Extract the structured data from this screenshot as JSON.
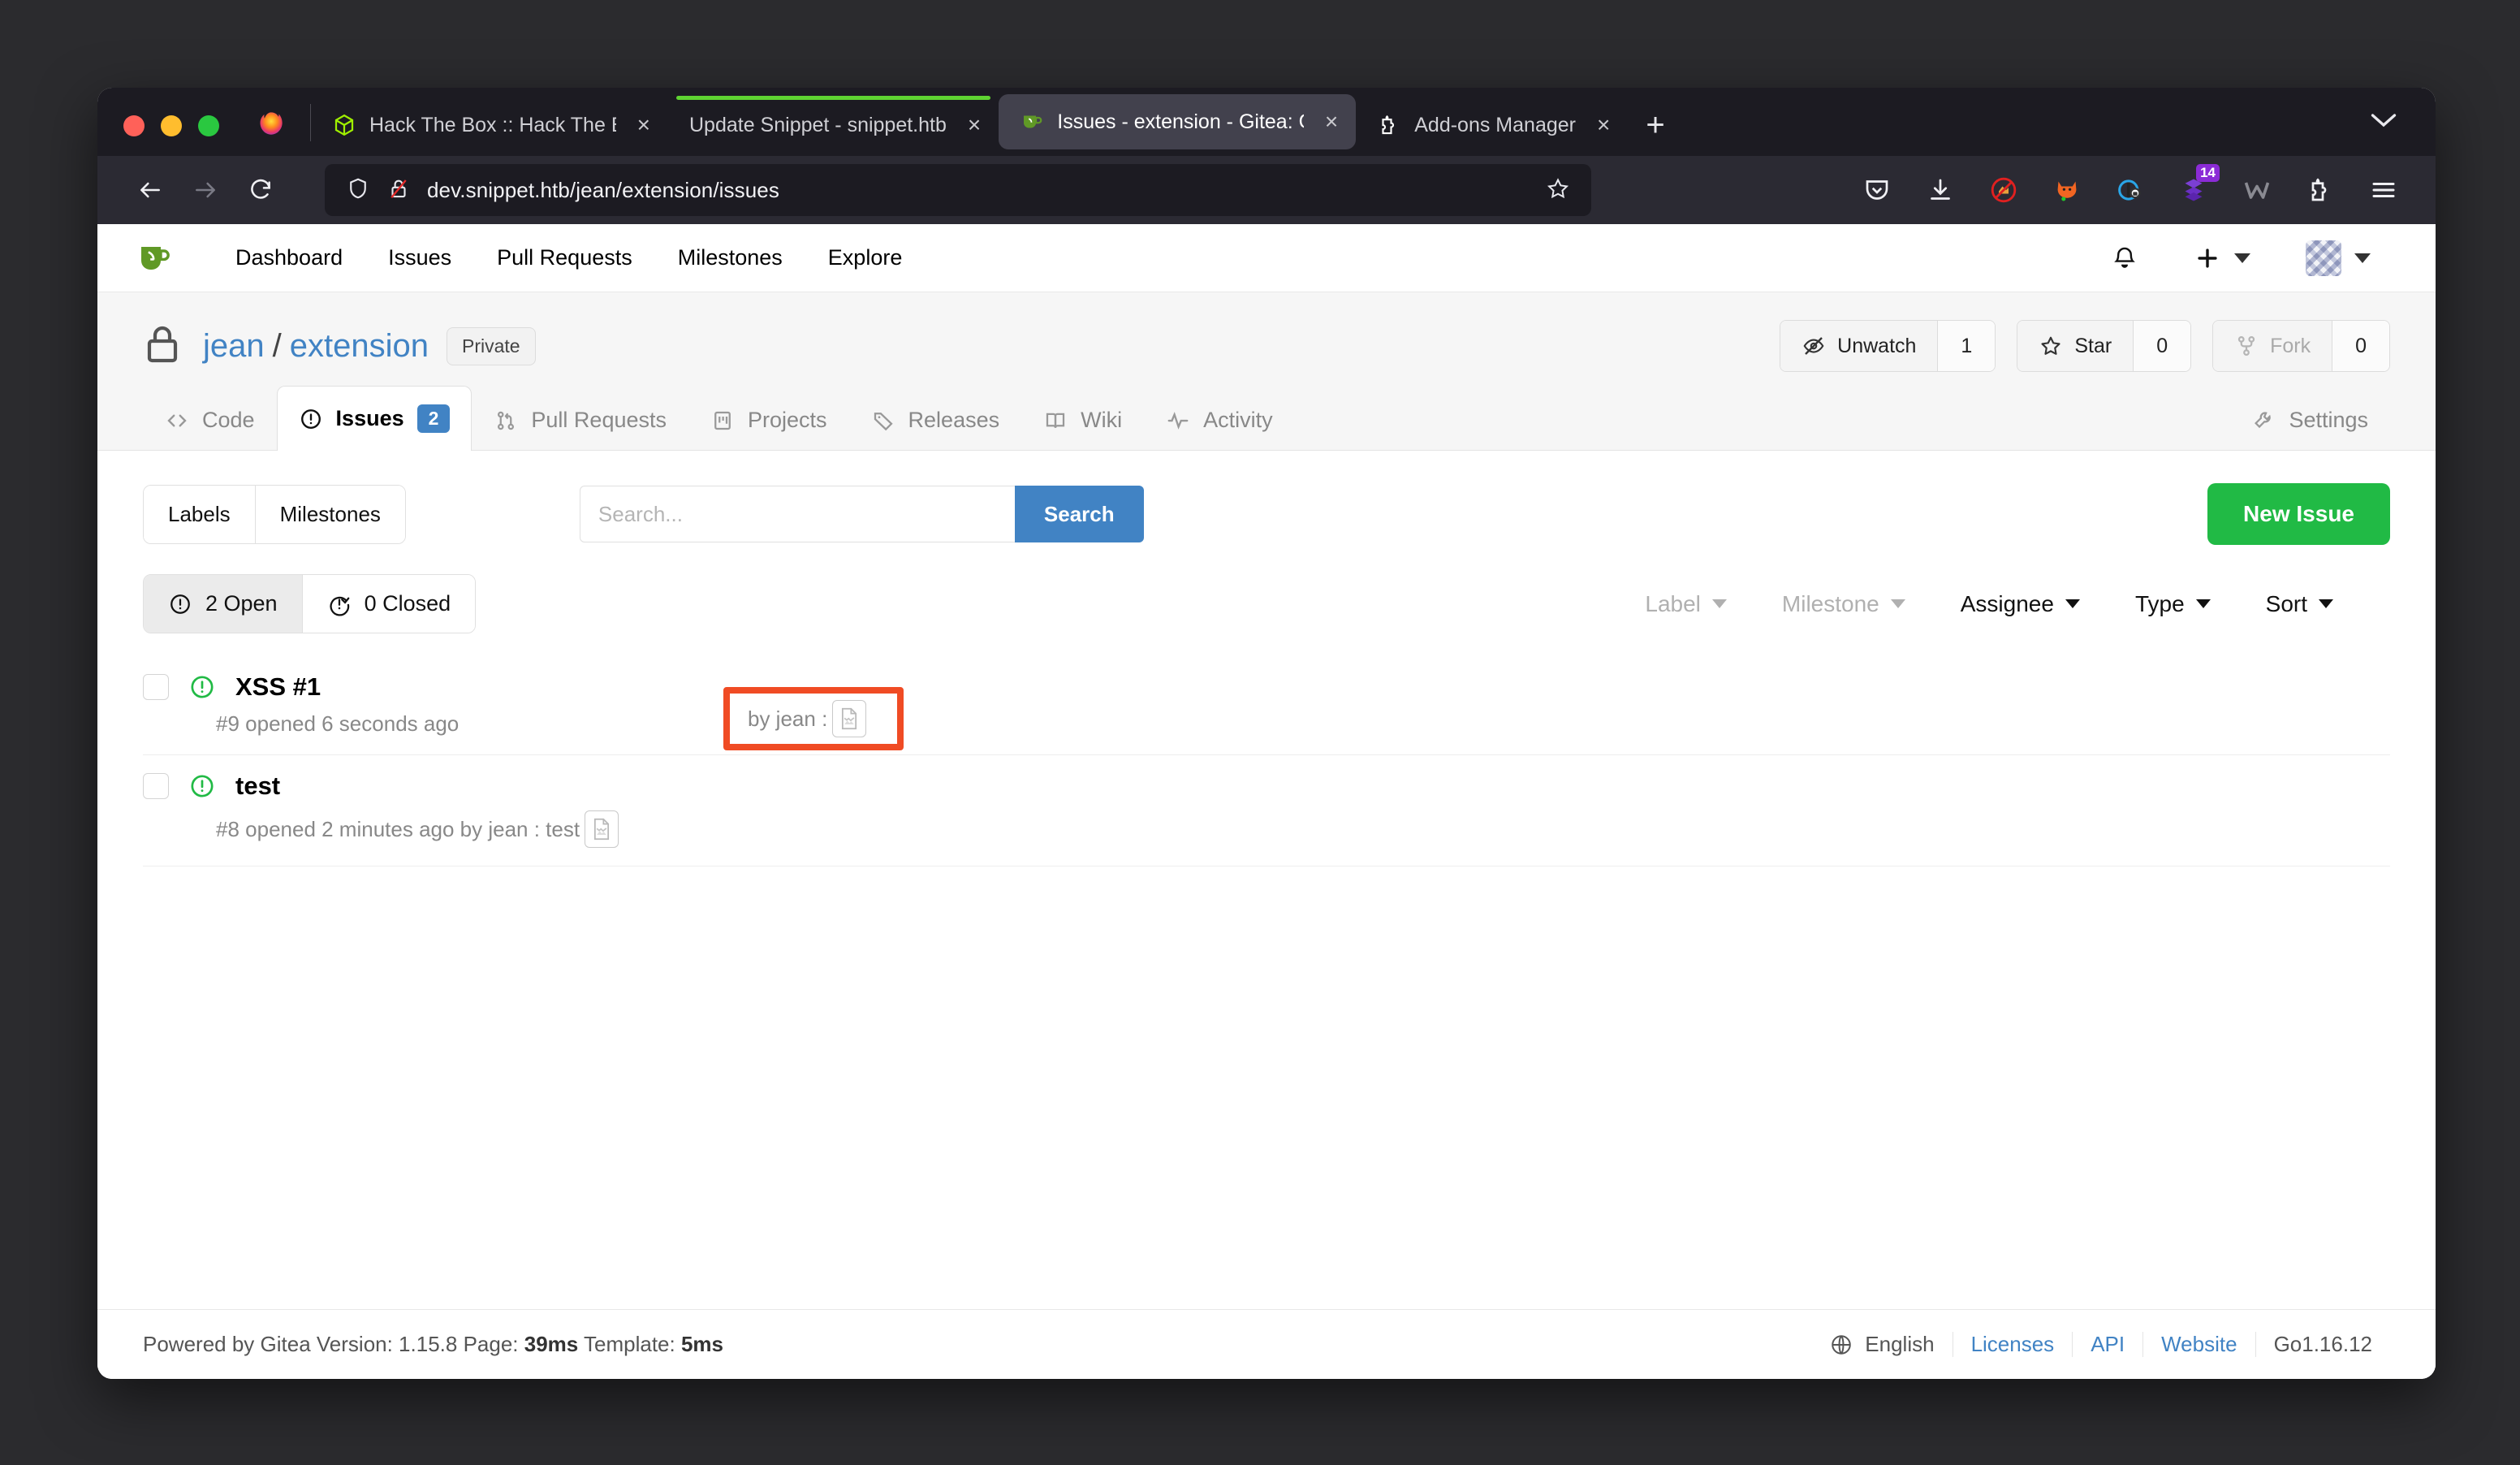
{
  "browser": {
    "tabs": [
      {
        "title": "Hack The Box :: Hack The Box",
        "favicon": "htb-icon",
        "active": false,
        "loading": false,
        "close": "×"
      },
      {
        "title": "Update Snippet - snippet.htb",
        "favicon": "none",
        "active": false,
        "loading": true,
        "close": "×"
      },
      {
        "title": "Issues - extension - Gitea: Git wi",
        "favicon": "gitea-icon",
        "active": true,
        "loading": false,
        "close": "×"
      },
      {
        "title": "Add-ons Manager",
        "favicon": "addons-icon",
        "active": false,
        "loading": false,
        "close": "×"
      }
    ],
    "new_tab_label": "+",
    "url": "dev.snippet.htb/jean/extension/issues",
    "toolbar_icons": [
      "pocket-icon",
      "download-icon",
      "no-adblock-icon",
      "foxyproxy-icon",
      "privacy-badger-icon",
      "violentmonkey-icon",
      "wappalyzer-icon",
      "addons-icon",
      "menu-icon"
    ],
    "extension_badge": "14",
    "nav_icons": [
      "back-arrow-icon",
      "forward-arrow-icon",
      "reload-icon"
    ],
    "url_icons": [
      "shield-icon",
      "insecure-lock-icon",
      "bookmark-star-icon"
    ]
  },
  "gitea_nav": {
    "brand": "gitea-logo",
    "items": [
      {
        "label": "Dashboard"
      },
      {
        "label": "Issues"
      },
      {
        "label": "Pull Requests"
      },
      {
        "label": "Milestones"
      },
      {
        "label": "Explore"
      }
    ],
    "right": {
      "bell": "bell-icon",
      "plus": "plus-icon",
      "avatar": "user-avatar"
    }
  },
  "repo": {
    "owner": "jean",
    "separator": "/",
    "name": "extension",
    "visibility": "Private",
    "actions": [
      {
        "label": "Unwatch",
        "count": "1",
        "icon": "eye-slash-icon",
        "disabled": false
      },
      {
        "label": "Star",
        "count": "0",
        "icon": "star-icon",
        "disabled": false
      },
      {
        "label": "Fork",
        "count": "0",
        "icon": "fork-icon",
        "disabled": true
      }
    ],
    "tabs": [
      {
        "label": "Code",
        "icon": "code-icon",
        "active": false,
        "pill": null
      },
      {
        "label": "Issues",
        "icon": "issue-opened-icon",
        "active": true,
        "pill": "2"
      },
      {
        "label": "Pull Requests",
        "icon": "git-pull-request-icon",
        "active": false,
        "pill": null
      },
      {
        "label": "Projects",
        "icon": "project-icon",
        "active": false,
        "pill": null
      },
      {
        "label": "Releases",
        "icon": "tag-icon",
        "active": false,
        "pill": null
      },
      {
        "label": "Wiki",
        "icon": "book-icon",
        "active": false,
        "pill": null
      },
      {
        "label": "Activity",
        "icon": "pulse-icon",
        "active": false,
        "pill": null
      }
    ],
    "settings_tab": {
      "label": "Settings",
      "icon": "tools-icon"
    }
  },
  "issues_page": {
    "labels_button": "Labels",
    "milestones_button": "Milestones",
    "search_placeholder": "Search...",
    "search_value": "",
    "search_button": "Search",
    "new_issue_button": "New Issue",
    "states": [
      {
        "label": "2 Open",
        "icon": "issue-opened-icon",
        "active": true
      },
      {
        "label": "0 Closed",
        "icon": "issue-closed-icon",
        "active": false
      }
    ],
    "filters": [
      {
        "label": "Label",
        "dim": true
      },
      {
        "label": "Milestone",
        "dim": true
      },
      {
        "label": "Assignee",
        "dim": false
      },
      {
        "label": "Type",
        "dim": false
      },
      {
        "label": "Sort",
        "dim": false
      }
    ],
    "issues": [
      {
        "title": "XSS #1",
        "meta_prefix": "#9 opened 6 seconds ago",
        "meta_by": "by jean : ",
        "has_broken_image": true,
        "state": "open",
        "highlighted": true
      },
      {
        "title": "test",
        "meta_prefix": "#8 opened 2 minutes ago by jean : test",
        "meta_by": "",
        "has_broken_image": true,
        "state": "open",
        "highlighted": false
      }
    ],
    "highlight_color": "#f04b24"
  },
  "footer": {
    "powered_by": "Powered by Gitea Version: 1.15.8 Page: ",
    "page_ms": "39ms",
    "template_label": " Template: ",
    "template_ms": "5ms",
    "language": "English",
    "links": [
      "Licenses",
      "API",
      "Website"
    ],
    "go_version": "Go1.16.12"
  },
  "colors": {
    "accent_blue": "#4183c4",
    "green": "#21ba45",
    "highlight_red": "#f04b24",
    "chrome_dark": "#2b2a33",
    "tabstrip_dark": "#1c1b22"
  }
}
